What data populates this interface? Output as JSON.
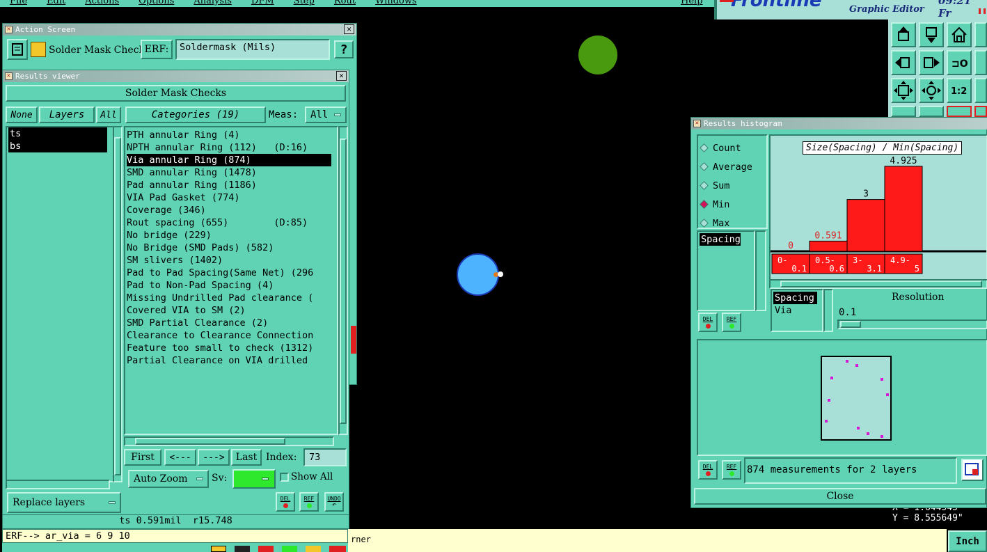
{
  "menu": {
    "items": [
      "File",
      "Edit",
      "Actions",
      "Options",
      "Analysis",
      "DFM",
      "Step",
      "Rout",
      "Windows"
    ],
    "help": "Help",
    "logo": "Frontline",
    "subtitle": "Graphic Editor",
    "time": "09:21 Fr"
  },
  "action_screen": {
    "title": "Action Screen",
    "action_name": "Solder Mask Checks",
    "erf_label": "ERF:",
    "erf_value": "Soldermask (Mils)",
    "help_btn": "?"
  },
  "results_viewer": {
    "title": "Results viewer",
    "header": "Solder Mask Checks",
    "none_btn": "None",
    "layers_btn": "Layers",
    "all_btn": "All",
    "categories_btn": "Categories (19)",
    "meas_label": "Meas:",
    "meas_value": "All",
    "layers": [
      "ts",
      "bs"
    ],
    "categories": [
      "PTH annular Ring (4)",
      "NPTH annular Ring (112)   (D:16)",
      "Via annular Ring (874)",
      "SMD annular Ring (1478)",
      "Pad annular Ring (1186)",
      "VIA Pad Gasket (774)",
      "Coverage (346)",
      "Rout spacing (655)        (D:85)",
      "No bridge (229)",
      "No Bridge (SMD Pads) (582)",
      "SM slivers (1402)",
      "Pad to Pad Spacing(Same Net) (296",
      "Pad to Non-Pad Spacing (4)",
      "Missing Undrilled Pad clearance (",
      "Covered VIA to SM (2)",
      "SMD Partial Clearance (2)",
      "Clearance to Clearance Connection",
      "Feature too small to check (1312)",
      "Partial Clearance on VIA drilled"
    ],
    "first_btn": "First",
    "prev_btn": "<---",
    "next_btn": "--->",
    "last_btn": "Last",
    "index_label": "Index:",
    "index_value": "73",
    "zoom_value": "Auto Zoom",
    "sv_label": "Sv:",
    "show_all": "Show All",
    "replace_layers": "Replace layers",
    "del": "DEL",
    "ref": "REF",
    "undo": "UNDO",
    "status": "ts 0.591mil  r15.748"
  },
  "command_line": "ERF--> ar_via = 6 9 10",
  "bottom_msg": "rner",
  "histogram": {
    "title": "Results histogram",
    "options": [
      "Count",
      "Average",
      "Sum",
      "Min",
      "Max"
    ],
    "selected_option": "Min",
    "chart_title": "Size(Spacing) / Min(Spacing)",
    "measure_list": [
      "Spacing"
    ],
    "feature_list": [
      "Spacing",
      "Via"
    ],
    "resolution_label": "Resolution",
    "resolution_value": "0.1",
    "summary": "874 measurements for 2 layers",
    "close": "Close",
    "del": "DEL",
    "ref": "REF"
  },
  "chart_data": {
    "type": "bar",
    "categories": [
      "0-\n0.1",
      "0.5-\n0.6",
      "3-\n3.1",
      "4.9-\n5"
    ],
    "values": [
      0,
      0.591,
      3,
      4.925
    ],
    "value_labels": [
      "0",
      "0.591",
      "3",
      "4.925"
    ],
    "ylim": [
      0,
      5
    ],
    "bar_color": "#ff1a1a",
    "title": "Size(Spacing) / Min(Spacing)"
  },
  "coords": {
    "x": "X = 1.644545",
    "y": "Y = 8.555649\""
  },
  "units_btn": "Inch",
  "colors": {
    "panel": "#5fd3b4",
    "pad_blue": "#4db3ff",
    "pad_green": "#4a9a10",
    "highlight_red": "#ff1a1a"
  }
}
